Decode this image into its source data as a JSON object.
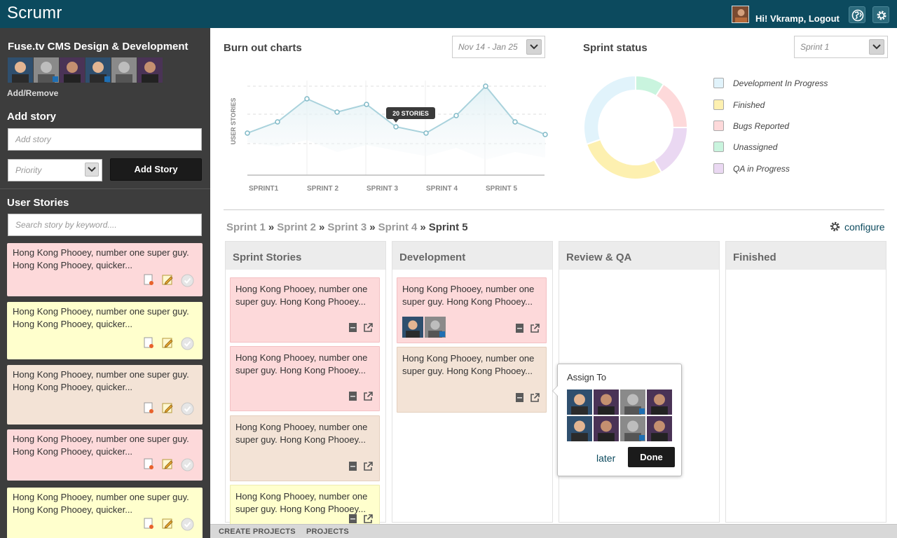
{
  "app": {
    "title": "Scrumr"
  },
  "header": {
    "greeting": "Hi! Vkramp, Logout",
    "globe_icon": "globe-icon",
    "settings_icon": "gear-icon"
  },
  "sidebar": {
    "project_title": "Fuse.tv CMS Design & Development",
    "add_remove_label": "Add/Remove",
    "add_story_title": "Add story",
    "add_story_placeholder": "Add story",
    "priority_placeholder": "Priority",
    "add_story_button": "Add Story",
    "user_stories_title": "User Stories",
    "search_placeholder": "Search story by keyword....",
    "stories": [
      {
        "text": "Hong Kong Phooey, number one super guy. Hong Kong Phooey, quicker...",
        "color": "#fdd9da"
      },
      {
        "text": "Hong Kong Phooey, number one super guy. Hong Kong Phooey, quicker...",
        "color": "#ffffcd"
      },
      {
        "text": "Hong Kong Phooey, number one super guy. Hong Kong Phooey, quicker...",
        "color": "#f3e3d6"
      },
      {
        "text": "Hong Kong Phooey, number one super guy. Hong Kong Phooey, quicker...",
        "color": "#fdd9da"
      },
      {
        "text": "Hong Kong Phooey, number one super guy. Hong Kong Phooey, quicker...",
        "color": "#ffffcd"
      }
    ]
  },
  "burnout": {
    "title": "Burn out charts",
    "range": "Nov 14 - Jan 25",
    "ylabel": "USER STORIES",
    "sprints": [
      "SPRINT1",
      "SPRINT 2",
      "SPRINT 3",
      "SPRINT 4",
      "SPRINT 5"
    ],
    "tooltip": "20 STORIES"
  },
  "sprint_status": {
    "title": "Sprint status",
    "selected": "Sprint 1",
    "legend": [
      {
        "label": "Development In Progress",
        "color": "#e1f3fb"
      },
      {
        "label": "Finished",
        "color": "#fdf0b0"
      },
      {
        "label": "Bugs Reported",
        "color": "#fdd9da"
      },
      {
        "label": "Unassigned",
        "color": "#c9f4de"
      },
      {
        "label": "QA in Progress",
        "color": "#ead8f2"
      }
    ]
  },
  "breadcrumb": {
    "items": [
      "Sprint 1",
      "Sprint 2",
      "Sprint 3",
      "Sprint 4"
    ],
    "current": "Sprint 5",
    "sep": "»"
  },
  "configure_label": "configure",
  "columns": [
    {
      "title": "Sprint Stories"
    },
    {
      "title": "Development"
    },
    {
      "title": "Review & QA"
    },
    {
      "title": "Finished"
    }
  ],
  "cards": {
    "sprint_stories": [
      "Hong Kong Phooey, number one super guy. Hong Kong Phooey...",
      "Hong Kong Phooey, number one super guy. Hong Kong Phooey...",
      "Hong Kong Phooey, number one super guy. Hong Kong Phooey...",
      "Hong Kong Phooey, number one super guy. Hong Kong Phooey..."
    ],
    "development": [
      "Hong Kong Phooey, number one super guy. Hong Kong Phooey...",
      "Hong Kong Phooey, number one super guy. Hong Kong Phooey..."
    ]
  },
  "assign_popover": {
    "title": "Assign To",
    "later": "later",
    "done": "Done"
  },
  "footer": {
    "create_projects": "CREATE PROJECTS",
    "projects": "PROJECTS"
  }
}
